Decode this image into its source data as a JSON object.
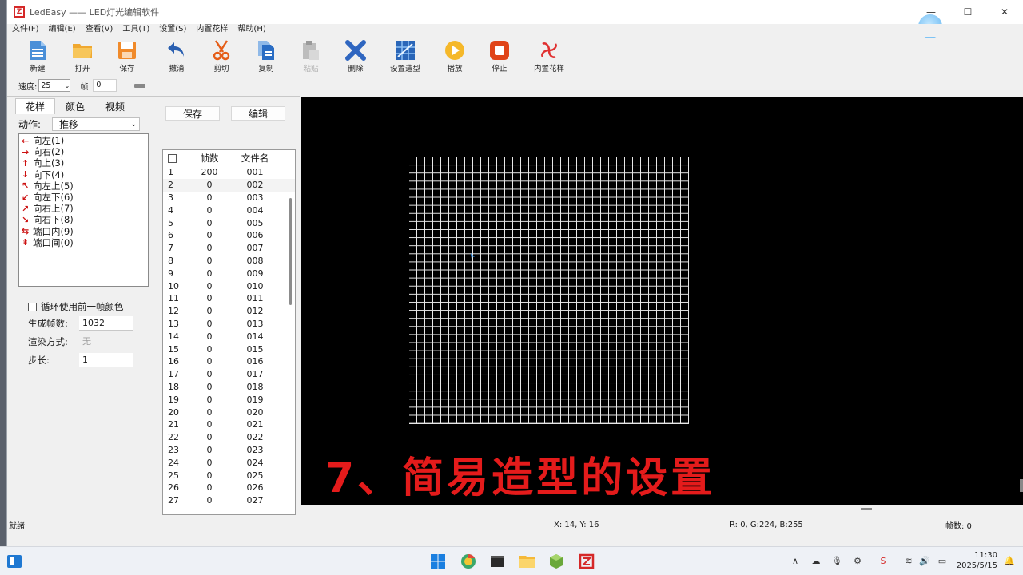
{
  "window": {
    "title": "LedEasy —— LED灯光编辑软件",
    "min": "—",
    "max": "☐",
    "close": "✕"
  },
  "menu": [
    "文件(F)",
    "编辑(E)",
    "查看(V)",
    "工具(T)",
    "设置(S)",
    "内置花样",
    "帮助(H)"
  ],
  "toolbar": {
    "new": "新建",
    "open": "打开",
    "save": "保存",
    "undo": "撤消",
    "cut": "剪切",
    "copy": "复制",
    "paste": "粘贴",
    "delete": "删除",
    "shape": "设置造型",
    "play": "播放",
    "stop": "停止",
    "builtin": "内置花样"
  },
  "speedbar": {
    "speed_label": "速度:",
    "speed_value": "25",
    "frame_label": "帧",
    "frame_value": "0"
  },
  "tabs": [
    "花样",
    "颜色",
    "视频"
  ],
  "action": {
    "label": "动作:",
    "value": "推移"
  },
  "patterns": [
    {
      "arrow": "←",
      "label": "向左(1)"
    },
    {
      "arrow": "→",
      "label": "向右(2)"
    },
    {
      "arrow": "↑",
      "label": "向上(3)"
    },
    {
      "arrow": "↓",
      "label": "向下(4)"
    },
    {
      "arrow": "↖",
      "label": "向左上(5)"
    },
    {
      "arrow": "↙",
      "label": "向左下(6)"
    },
    {
      "arrow": "↗",
      "label": "向右上(7)"
    },
    {
      "arrow": "↘",
      "label": "向右下(8)"
    },
    {
      "arrow": "⇆",
      "label": "端口内(9)"
    },
    {
      "arrow": "⇞",
      "label": "端口间(0)"
    }
  ],
  "options": {
    "loop_label": "循环使用前一帧颜色",
    "frames_label": "生成帧数:",
    "frames_value": "1032",
    "render_label": "渲染方式:",
    "render_value": "无",
    "step_label": "步长:",
    "step_value": "1"
  },
  "buttons": {
    "save": "保存",
    "edit": "编辑"
  },
  "frame_table": {
    "headers": [
      "帧数",
      "文件名"
    ],
    "rows": [
      [
        "1",
        "200",
        "001"
      ],
      [
        "2",
        "0",
        "002"
      ],
      [
        "3",
        "0",
        "003"
      ],
      [
        "4",
        "0",
        "004"
      ],
      [
        "5",
        "0",
        "005"
      ],
      [
        "6",
        "0",
        "006"
      ],
      [
        "7",
        "0",
        "007"
      ],
      [
        "8",
        "0",
        "008"
      ],
      [
        "9",
        "0",
        "009"
      ],
      [
        "10",
        "0",
        "010"
      ],
      [
        "11",
        "0",
        "011"
      ],
      [
        "12",
        "0",
        "012"
      ],
      [
        "13",
        "0",
        "013"
      ],
      [
        "14",
        "0",
        "014"
      ],
      [
        "15",
        "0",
        "015"
      ],
      [
        "16",
        "0",
        "016"
      ],
      [
        "17",
        "0",
        "017"
      ],
      [
        "18",
        "0",
        "018"
      ],
      [
        "19",
        "0",
        "019"
      ],
      [
        "20",
        "0",
        "020"
      ],
      [
        "21",
        "0",
        "021"
      ],
      [
        "22",
        "0",
        "022"
      ],
      [
        "23",
        "0",
        "023"
      ],
      [
        "24",
        "0",
        "024"
      ],
      [
        "25",
        "0",
        "025"
      ],
      [
        "26",
        "0",
        "026"
      ],
      [
        "27",
        "0",
        "027"
      ]
    ]
  },
  "caption": "7、简易造型的设置",
  "status": {
    "ready": "就绪",
    "coords": "X: 14, Y: 16",
    "rgb": "R: 0, G:224, B:255",
    "frames": "帧数: 0"
  },
  "clock": {
    "time": "11:30",
    "date": "2025/5/15"
  },
  "colors": {
    "accent_red": "#e41b1b",
    "canvas": "#000000",
    "grid": "#e8e8e8"
  }
}
